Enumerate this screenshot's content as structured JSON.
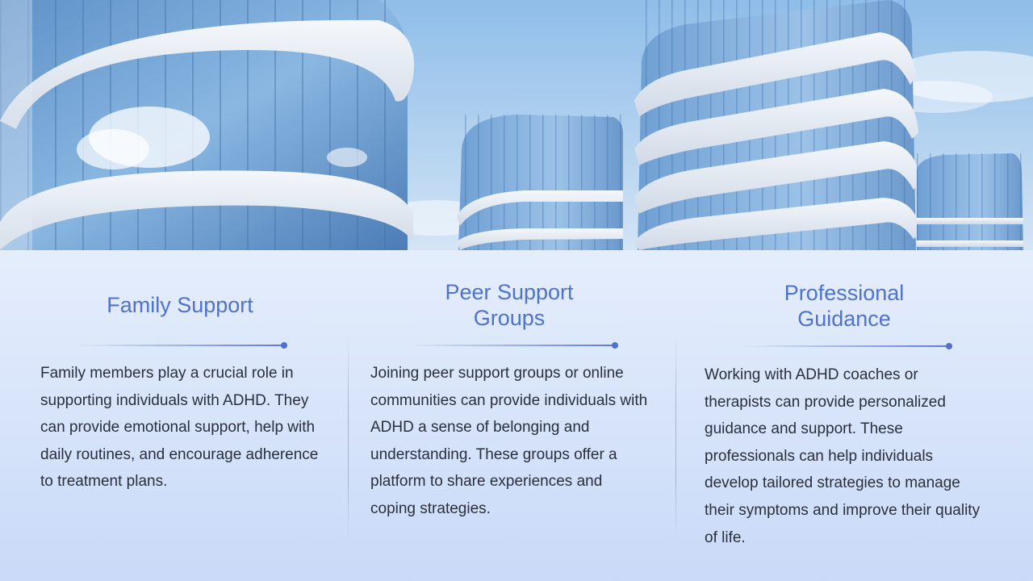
{
  "columns": [
    {
      "title": "Family Support",
      "body": "Family members play a crucial role in supporting individuals with ADHD. They can provide emotional support, help with daily routines, and encourage adherence to treatment plans."
    },
    {
      "title": "Peer Support Groups",
      "body": "Joining peer support groups or online communities can provide individuals with ADHD a sense of belonging and understanding. These groups offer a platform to share experiences and coping strategies."
    },
    {
      "title": "Professional Guidance",
      "body": "Working with ADHD coaches or therapists can provide personalized guidance and support. These professionals can help individuals develop tailored strategies to manage their symptoms and improve their quality of life."
    }
  ],
  "colors": {
    "title": "#4f73c9",
    "body_text": "#2a2f3d",
    "accent_line": "#5b7cd6",
    "background_top": "#f3f7fe",
    "background_bottom": "#c9daf8"
  },
  "hero_image": "modern glass office buildings under blue sky"
}
